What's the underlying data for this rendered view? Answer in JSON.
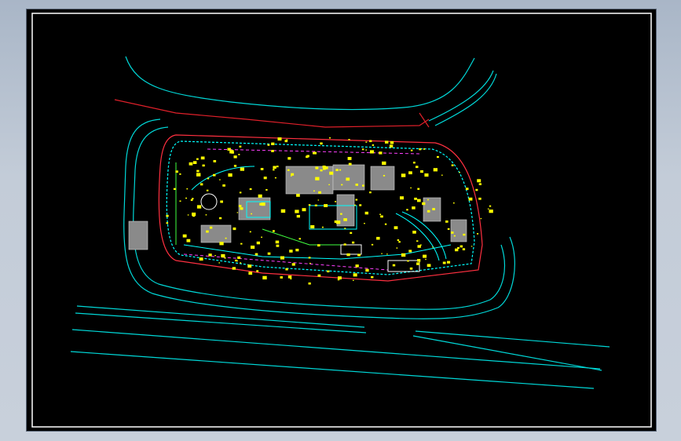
{
  "viewer": {
    "background_color": "#b8c3d1",
    "sheet_color": "#000000",
    "border_color": "#ffffff"
  },
  "drawing": {
    "type": "cad-site-plan",
    "layer_colors": {
      "road_lines": "#00d8d8",
      "boundary": "#e0202a",
      "planting": "#ffff00",
      "paths": "#00ffff",
      "buildings": "#9a9a9a",
      "accent_red": "#ff3040",
      "accent_magenta": "#ff40ff",
      "accent_green": "#40ff40",
      "accent_white": "#ffffff"
    }
  }
}
